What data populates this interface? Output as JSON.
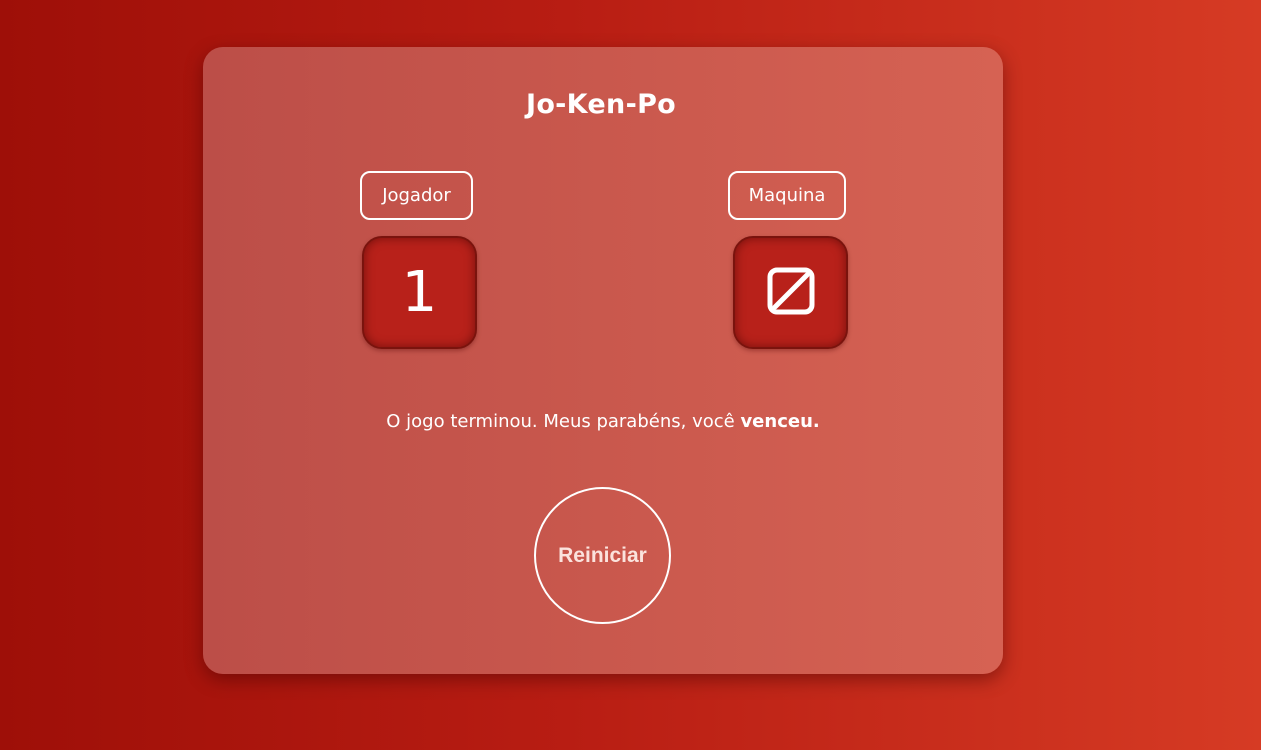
{
  "app": {
    "title": "Jo-Ken-Po"
  },
  "player": {
    "label": "Jogador",
    "score": "1"
  },
  "machine": {
    "label": "Maquina",
    "score_icon": "empty-set-icon"
  },
  "result": {
    "message_prefix": "O jogo terminou. Meus parabéns, você ",
    "message_emphasis": "venceu."
  },
  "actions": {
    "restart_label": "Reiniciar"
  },
  "colors": {
    "background_start": "#9e0f08",
    "background_end": "#d63b24",
    "card": "#c9584d",
    "score_box": "#b8211a",
    "text": "#ffffff"
  }
}
